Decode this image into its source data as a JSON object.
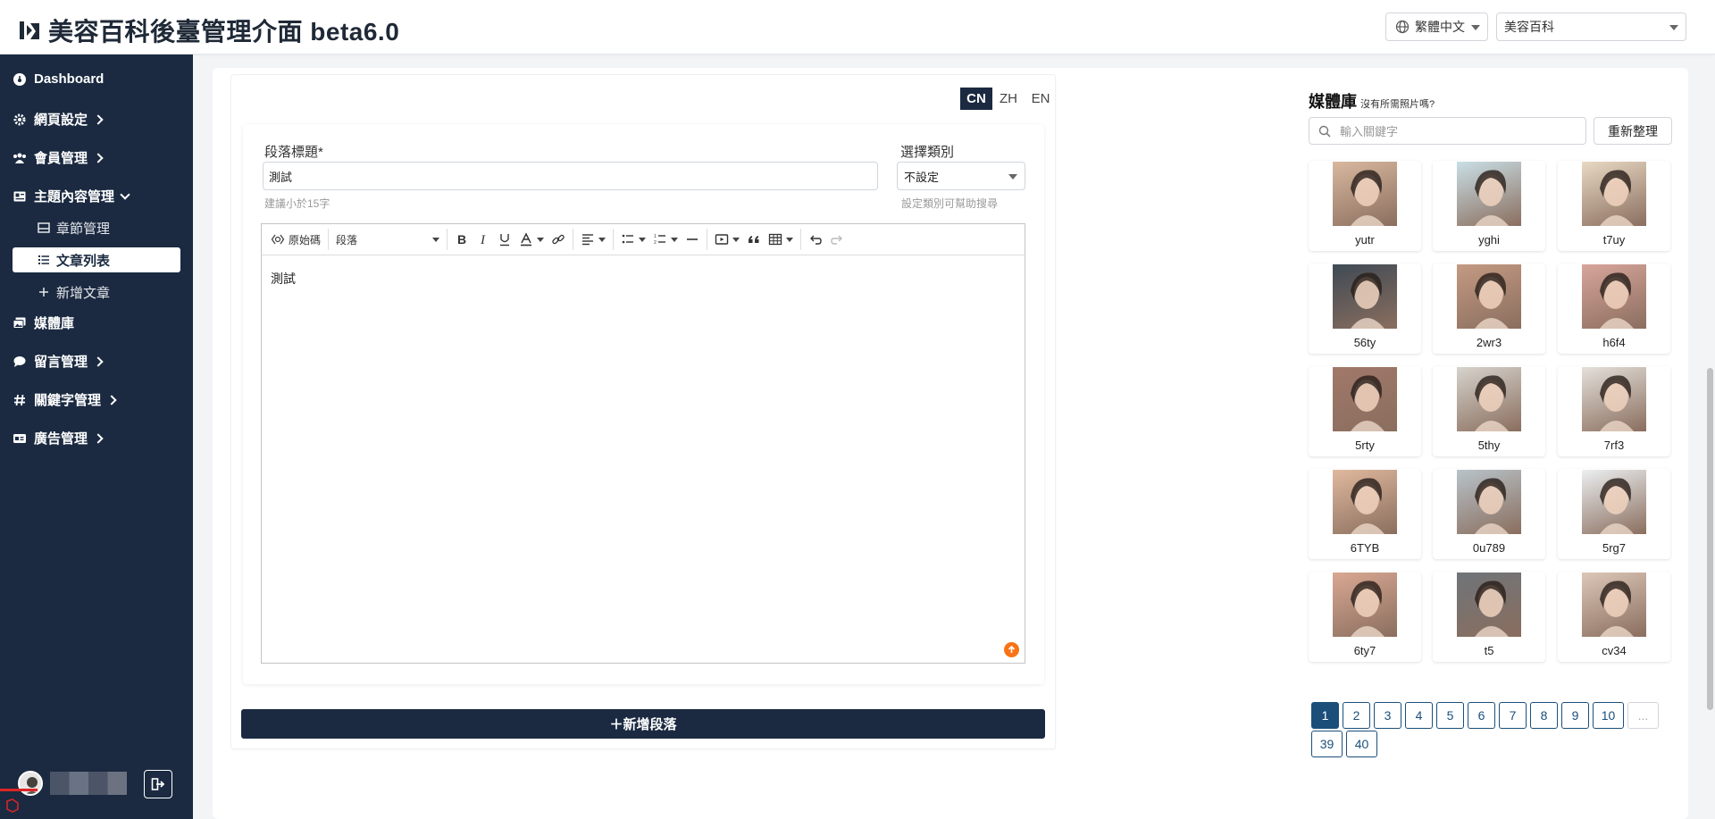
{
  "header": {
    "title": "美容百科後臺管理介面 beta6.0",
    "language_select": "繁體中文",
    "site_select": "美容百科"
  },
  "sidebar": {
    "items": [
      {
        "label": "Dashboard",
        "icon": "dashboard-icon"
      },
      {
        "label": "網頁設定",
        "icon": "gear-icon"
      },
      {
        "label": "會員管理",
        "icon": "users-icon"
      },
      {
        "label": "主題內容管理",
        "icon": "content-icon"
      },
      {
        "label": "媒體庫",
        "icon": "images-icon"
      },
      {
        "label": "留言管理",
        "icon": "comment-icon"
      },
      {
        "label": "關鍵字管理",
        "icon": "hash-icon"
      },
      {
        "label": "廣告管理",
        "icon": "ad-icon"
      }
    ],
    "subitems": [
      {
        "label": "章節管理",
        "icon": "chapter-icon"
      },
      {
        "label": "文章列表",
        "icon": "list-icon",
        "active": true
      },
      {
        "label": "新增文章",
        "icon": "plus-icon"
      }
    ]
  },
  "lang_tabs": [
    "CN",
    "ZH",
    "EN"
  ],
  "section": {
    "title_label": "段落標題*",
    "title_value": "測試",
    "title_hint": "建議小於15字",
    "category_label": "選擇類別",
    "category_value": "不設定",
    "category_hint": "設定類別可幫助搜尋",
    "toolbar": {
      "source_label": "原始碼",
      "paragraph_label": "段落"
    },
    "content": "測試"
  },
  "add_section_label": "＋新增段落",
  "media": {
    "title": "媒體庫",
    "subtitle": "沒有所需照片嗎?",
    "search_placeholder": "輸入關鍵字",
    "reset_label": "重新整理",
    "items": [
      {
        "label": "yutr",
        "tone": "#d9b89f"
      },
      {
        "label": "yghi",
        "tone": "#c9dfe6"
      },
      {
        "label": "t7uy",
        "tone": "#e8d9c4"
      },
      {
        "label": "56ty",
        "tone": "#3f4a55"
      },
      {
        "label": "2wr3",
        "tone": "#c49a83"
      },
      {
        "label": "h6f4",
        "tone": "#d8a59b"
      },
      {
        "label": "5rty",
        "tone": "#a1786a"
      },
      {
        "label": "5thy",
        "tone": "#d6d3cd"
      },
      {
        "label": "7rf3",
        "tone": "#e4e0da"
      },
      {
        "label": "6TYB",
        "tone": "#e0b99e"
      },
      {
        "label": "0u789",
        "tone": "#b8c3c9"
      },
      {
        "label": "5rg7",
        "tone": "#eceff1"
      },
      {
        "label": "6ty7",
        "tone": "#d9a893"
      },
      {
        "label": "t5",
        "tone": "#6f7479"
      },
      {
        "label": "cv34",
        "tone": "#dcc7b8"
      }
    ]
  },
  "pagination": {
    "pages": [
      "1",
      "2",
      "3",
      "4",
      "5",
      "6",
      "7",
      "8",
      "9",
      "10",
      "...",
      "39",
      "40"
    ],
    "active": "1"
  }
}
